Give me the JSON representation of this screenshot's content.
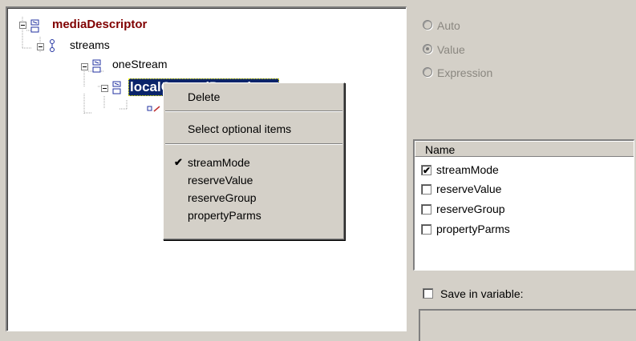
{
  "tree": {
    "root": {
      "label": "mediaDescriptor",
      "icon": "structure-icon"
    },
    "streams": {
      "label": "streams",
      "icon": "choice-icon"
    },
    "one_stream": {
      "label": "oneStream",
      "icon": "structure-icon"
    },
    "selected_node": {
      "label": "localControlDescriptor",
      "icon": "structure-icon"
    },
    "child_node": {
      "icon": "field-icon"
    }
  },
  "context_menu": {
    "delete": "Delete",
    "select_optional": "Select optional items",
    "items": [
      {
        "label": "streamMode",
        "checked": true
      },
      {
        "label": "reserveValue",
        "checked": false
      },
      {
        "label": "reserveGroup",
        "checked": false
      },
      {
        "label": "propertyParms",
        "checked": false
      }
    ],
    "check_glyph": "✔"
  },
  "value_mode": {
    "options": [
      "Auto",
      "Value",
      "Expression"
    ],
    "selected": "Value"
  },
  "optional_list": {
    "header": "Name",
    "items": [
      {
        "label": "streamMode",
        "checked": true
      },
      {
        "label": "reserveValue",
        "checked": false
      },
      {
        "label": "reserveGroup",
        "checked": false
      },
      {
        "label": "propertyParms",
        "checked": false
      }
    ],
    "check_glyph": "✔"
  },
  "save_variable": {
    "label": "Save in variable:",
    "checked": false,
    "value": ""
  },
  "colors": {
    "selection": "#0a246a",
    "root_text": "#800000",
    "panel": "#d4d0c8",
    "disabled_text": "#8a8780"
  }
}
